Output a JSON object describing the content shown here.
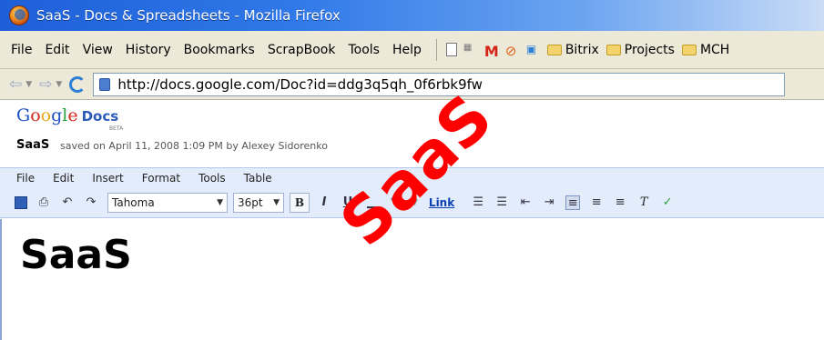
{
  "window": {
    "title": "SaaS - Docs & Spreadsheets - Mozilla Firefox"
  },
  "browser_menu": [
    "File",
    "Edit",
    "View",
    "History",
    "Bookmarks",
    "ScrapBook",
    "Tools",
    "Help"
  ],
  "bookmarks": {
    "gmail_label": "M",
    "folders": [
      "Bitrix",
      "Projects",
      "MCH"
    ]
  },
  "address_bar": {
    "url": "http://docs.google.com/Doc?id=ddg3q5qh_0f6rbk9fw"
  },
  "docs": {
    "logo_google": [
      "G",
      "o",
      "o",
      "g",
      "l",
      "e"
    ],
    "logo_docs": "Docs",
    "beta": "BETA",
    "doc_title": "SaaS",
    "saved_status": "saved on April 11, 2008 1:09 PM by Alexey Sidorenko",
    "menu": [
      "File",
      "Edit",
      "Insert",
      "Format",
      "Tools",
      "Table"
    ],
    "toolbar": {
      "font": "Tahoma",
      "size": "36pt",
      "bold": "B",
      "italic": "I",
      "underline": "U",
      "link": "Link"
    },
    "body_text": "SaaS"
  },
  "overlay": {
    "text": "SaaS",
    "color": "#ff0000"
  }
}
